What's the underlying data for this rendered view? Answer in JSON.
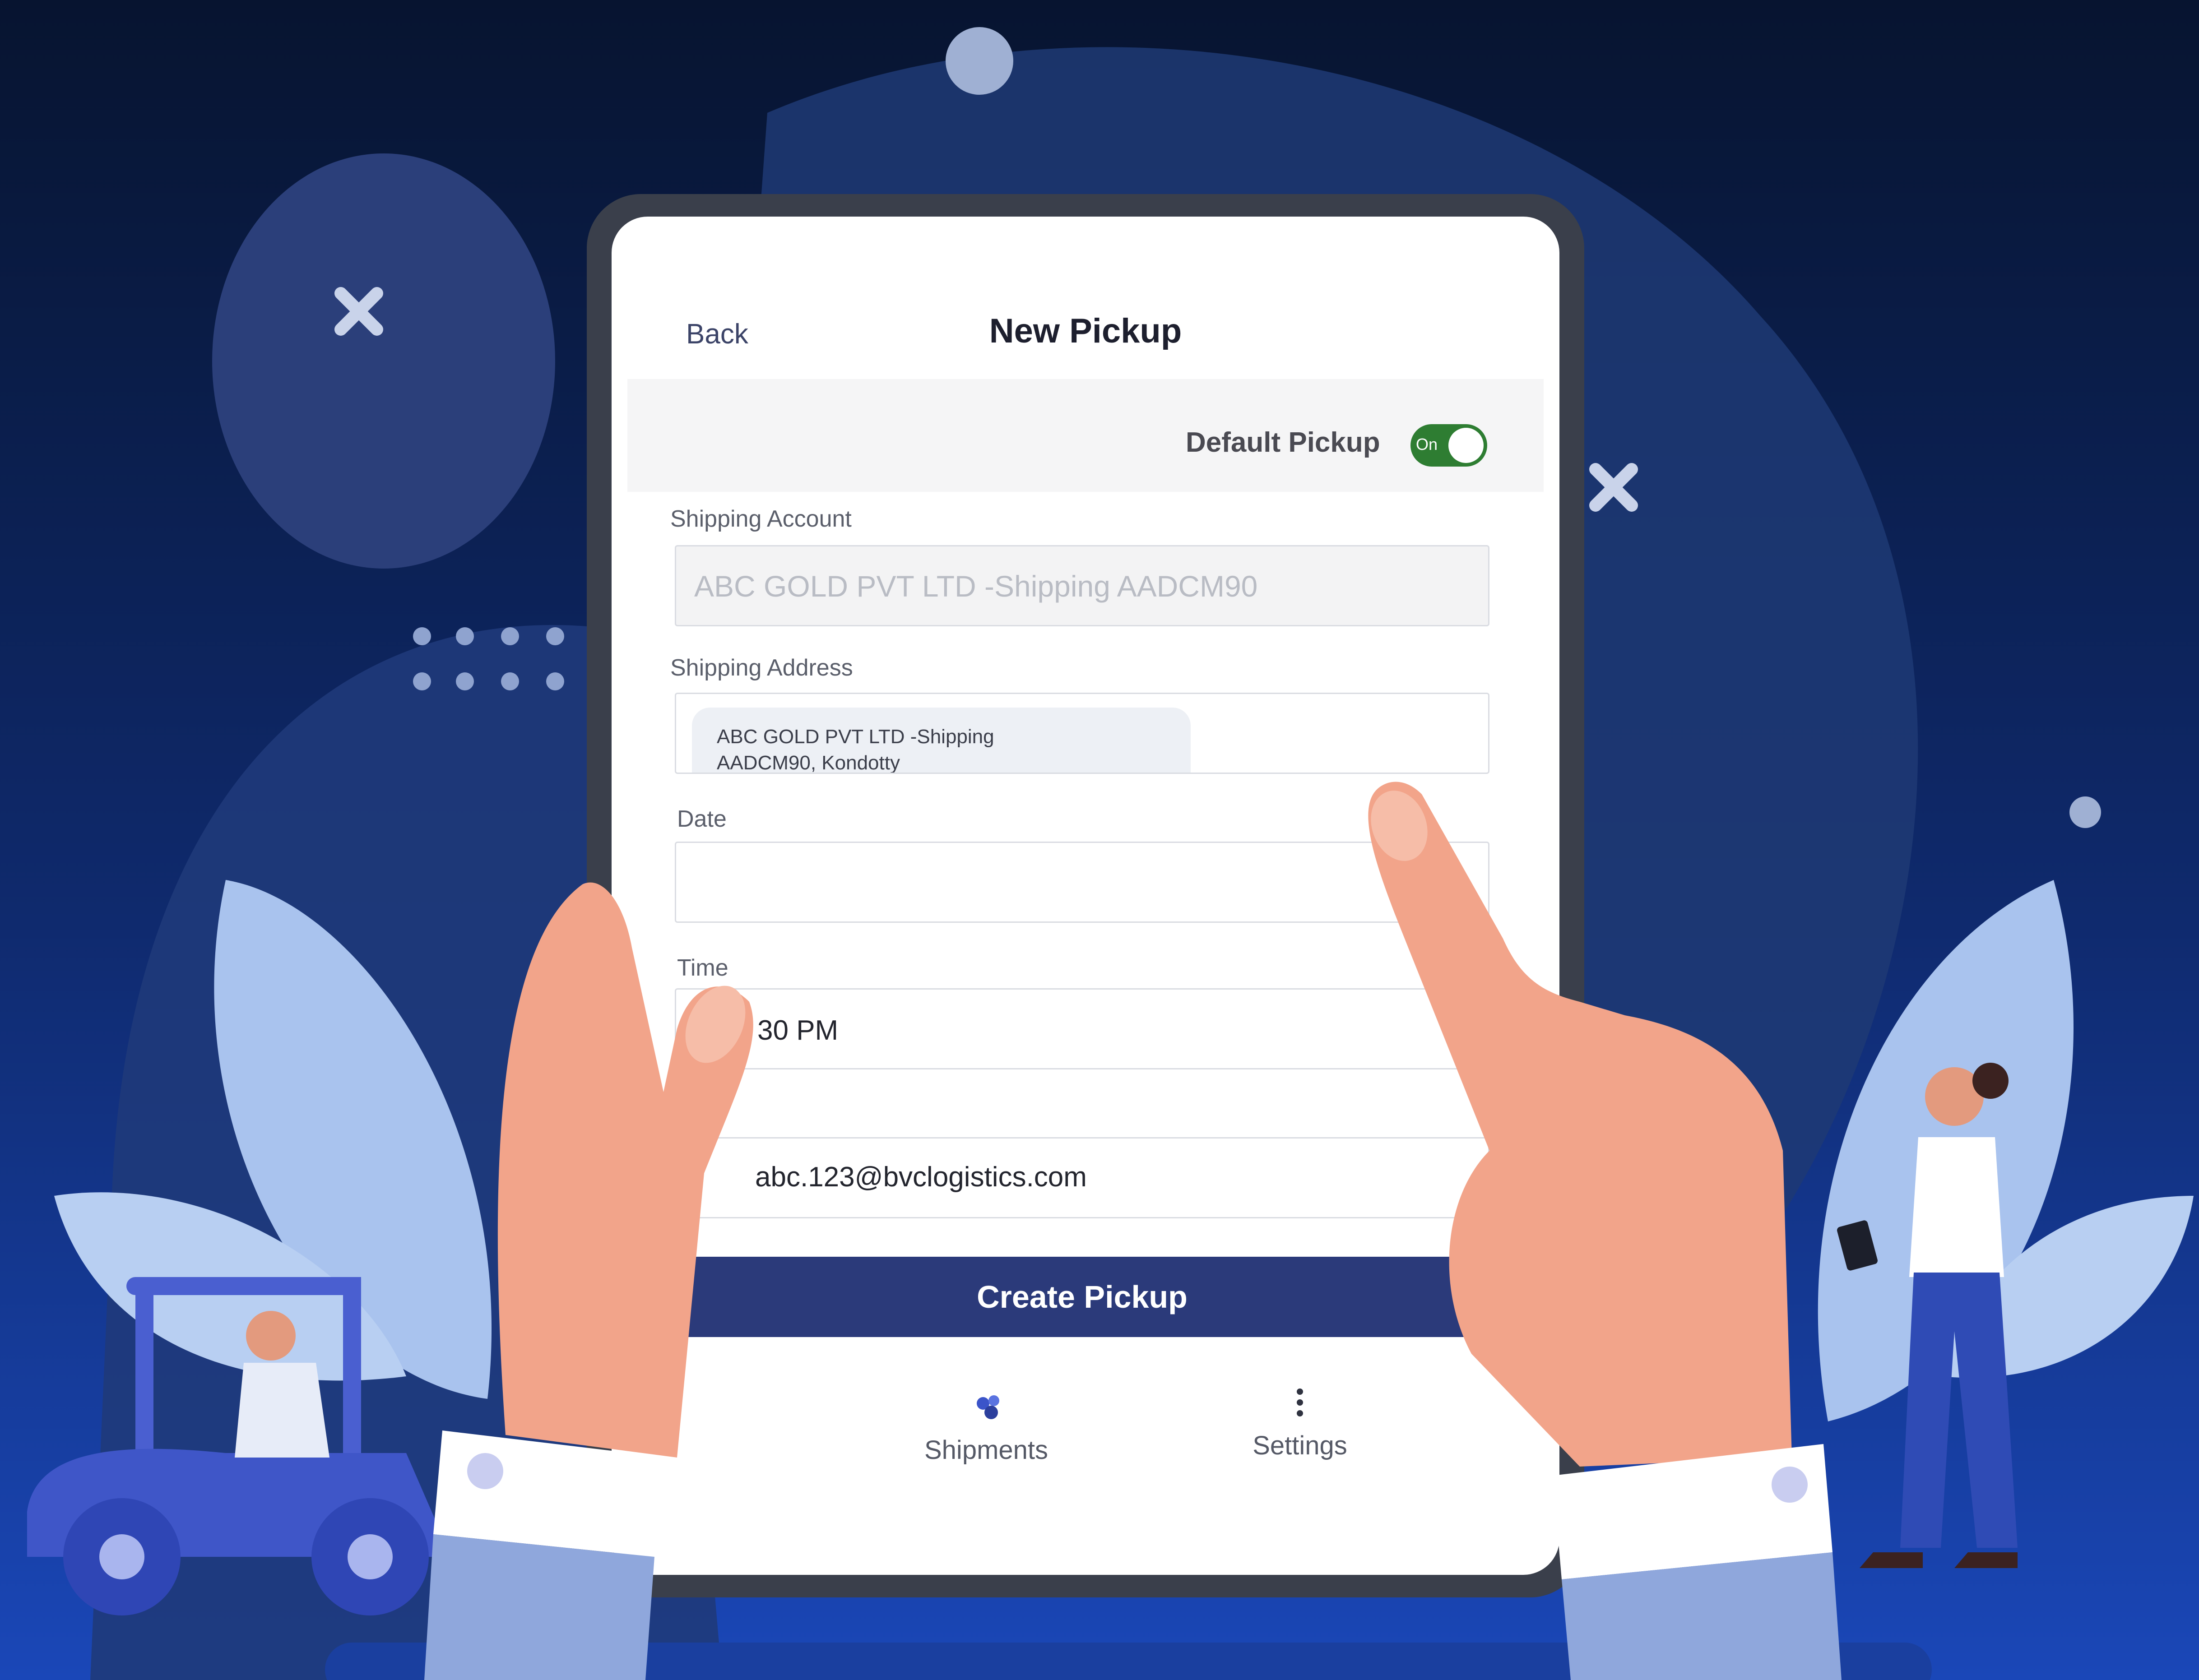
{
  "header": {
    "back_label": "Back",
    "title": "New Pickup"
  },
  "default_pickup": {
    "label": "Default Pickup",
    "toggle_text": "On",
    "enabled": true
  },
  "form": {
    "shipping_account": {
      "label": "Shipping Account",
      "value": "ABC GOLD PVT LTD -Shipping AADCM90"
    },
    "shipping_address": {
      "label": "Shipping Address",
      "chip_line1": "ABC GOLD PVT LTD -Shipping",
      "chip_line2": "AADCM90, Kondotty"
    },
    "date": {
      "label": "Date",
      "value": ""
    },
    "time": {
      "label": "Time",
      "value": "30 PM"
    },
    "email": {
      "value": "abc.123@bvclogistics.com"
    },
    "submit_label": "Create Pickup"
  },
  "tabbar": {
    "items": [
      {
        "label": "Shipments",
        "icon": "box-icon"
      },
      {
        "label": "Settings",
        "icon": "more-vertical-icon"
      }
    ]
  },
  "colors": {
    "background": "#0e2a6b",
    "primary": "#2b3a7a",
    "toggle_on": "#2e7d32",
    "skin": "#f2a48a"
  }
}
